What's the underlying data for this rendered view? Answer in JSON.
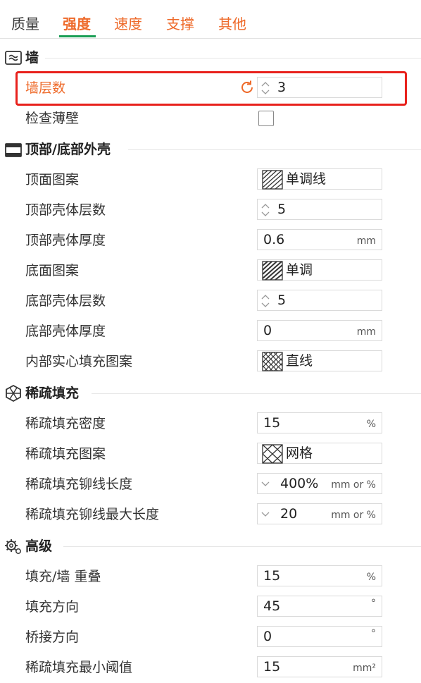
{
  "tabs": [
    {
      "label": "质量"
    },
    {
      "label": "强度"
    },
    {
      "label": "速度"
    },
    {
      "label": "支撑"
    },
    {
      "label": "其他"
    }
  ],
  "active_tab": "强度",
  "colors": {
    "accent": "#ee6a2a",
    "active_underline": "#1b9e55",
    "highlight": "#e8211c"
  },
  "sections": {
    "wall": {
      "title": "墙",
      "icon": "wall-icon"
    },
    "shell": {
      "title": "顶部/底部外壳",
      "icon": "shell-icon"
    },
    "infill": {
      "title": "稀疏填充",
      "icon": "infill-icon"
    },
    "advanced": {
      "title": "高级",
      "icon": "gear-icon"
    }
  },
  "settings": {
    "wall_loops": {
      "label": "墙层数",
      "value": "3"
    },
    "detect_thin_wall": {
      "label": "检查薄壁",
      "checked": false
    },
    "top_pattern": {
      "label": "顶面图案",
      "value": "单调线"
    },
    "top_layers": {
      "label": "顶部壳体层数",
      "value": "5"
    },
    "top_thickness": {
      "label": "顶部壳体厚度",
      "value": "0.6",
      "unit": "mm"
    },
    "bottom_pattern": {
      "label": "底面图案",
      "value": "单调"
    },
    "bottom_layers": {
      "label": "底部壳体层数",
      "value": "5"
    },
    "bottom_thickness": {
      "label": "底部壳体厚度",
      "value": "0",
      "unit": "mm"
    },
    "internal_solid_pattern": {
      "label": "内部实心填充图案",
      "value": "直线"
    },
    "infill_density": {
      "label": "稀疏填充密度",
      "value": "15",
      "unit": "%"
    },
    "infill_pattern": {
      "label": "稀疏填充图案",
      "value": "网格"
    },
    "anchor_length": {
      "label": "稀疏填充铆线长度",
      "value": "400%",
      "unit": "mm or %"
    },
    "anchor_max_length": {
      "label": "稀疏填充铆线最大长度",
      "value": "20",
      "unit": "mm or %"
    },
    "infill_wall_overlap": {
      "label": "填充/墙 重叠",
      "value": "15",
      "unit": "%"
    },
    "infill_direction": {
      "label": "填充方向",
      "value": "45",
      "unit": "°"
    },
    "bridge_direction": {
      "label": "桥接方向",
      "value": "0",
      "unit": "°"
    },
    "min_infill_threshold": {
      "label": "稀疏填充最小阈值",
      "value": "15",
      "unit": "mm²"
    }
  }
}
